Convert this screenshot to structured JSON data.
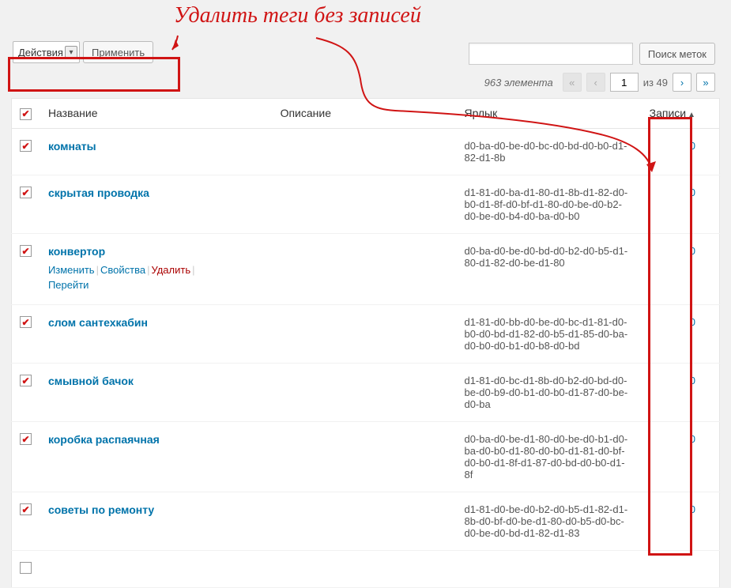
{
  "annotation_title": "Удалить теги без записей",
  "bulk": {
    "dropdown": "Действия",
    "apply": "Применить"
  },
  "search": {
    "placeholder": "",
    "button": "Поиск меток"
  },
  "pagination": {
    "count_text": "963 элемента",
    "current": "1",
    "of_text": "из 49"
  },
  "columns": {
    "name": "Название",
    "description": "Описание",
    "slug": "Ярлык",
    "count": "Записи"
  },
  "row_actions": {
    "edit": "Изменить",
    "quick": "Свойства",
    "delete": "Удалить",
    "view": "Перейти"
  },
  "rows": [
    {
      "name": "комнаты",
      "slug": "d0-ba-d0-be-d0-bc-d0-bd-d0-b0-d1-82-d1-8b",
      "count": "0",
      "show_actions": false
    },
    {
      "name": "скрытая проводка",
      "slug": "d1-81-d0-ba-d1-80-d1-8b-d1-82-d0-b0-d1-8f-d0-bf-d1-80-d0-be-d0-b2-d0-be-d0-b4-d0-ba-d0-b0",
      "count": "0",
      "show_actions": false
    },
    {
      "name": "конвертор",
      "slug": "d0-ba-d0-be-d0-bd-d0-b2-d0-b5-d1-80-d1-82-d0-be-d1-80",
      "count": "0",
      "show_actions": true
    },
    {
      "name": "слом сантехкабин",
      "slug": "d1-81-d0-bb-d0-be-d0-bc-d1-81-d0-b0-d0-bd-d1-82-d0-b5-d1-85-d0-ba-d0-b0-d0-b1-d0-b8-d0-bd",
      "count": "0",
      "show_actions": false
    },
    {
      "name": "смывной бачок",
      "slug": "d1-81-d0-bc-d1-8b-d0-b2-d0-bd-d0-be-d0-b9-d0-b1-d0-b0-d1-87-d0-be-d0-ba",
      "count": "0",
      "show_actions": false
    },
    {
      "name": "коробка распаячная",
      "slug": "d0-ba-d0-be-d1-80-d0-be-d0-b1-d0-ba-d0-b0-d1-80-d0-b0-d1-81-d0-bf-d0-b0-d1-8f-d1-87-d0-bd-d0-b0-d1-8f",
      "count": "0",
      "show_actions": false
    },
    {
      "name": "советы по ремонту",
      "slug": "d1-81-d0-be-d0-b2-d0-b5-d1-82-d1-8b-d0-bf-d0-be-d1-80-d0-b5-d0-bc-d0-be-d0-bd-d1-82-d1-83",
      "count": "0",
      "show_actions": false
    }
  ]
}
